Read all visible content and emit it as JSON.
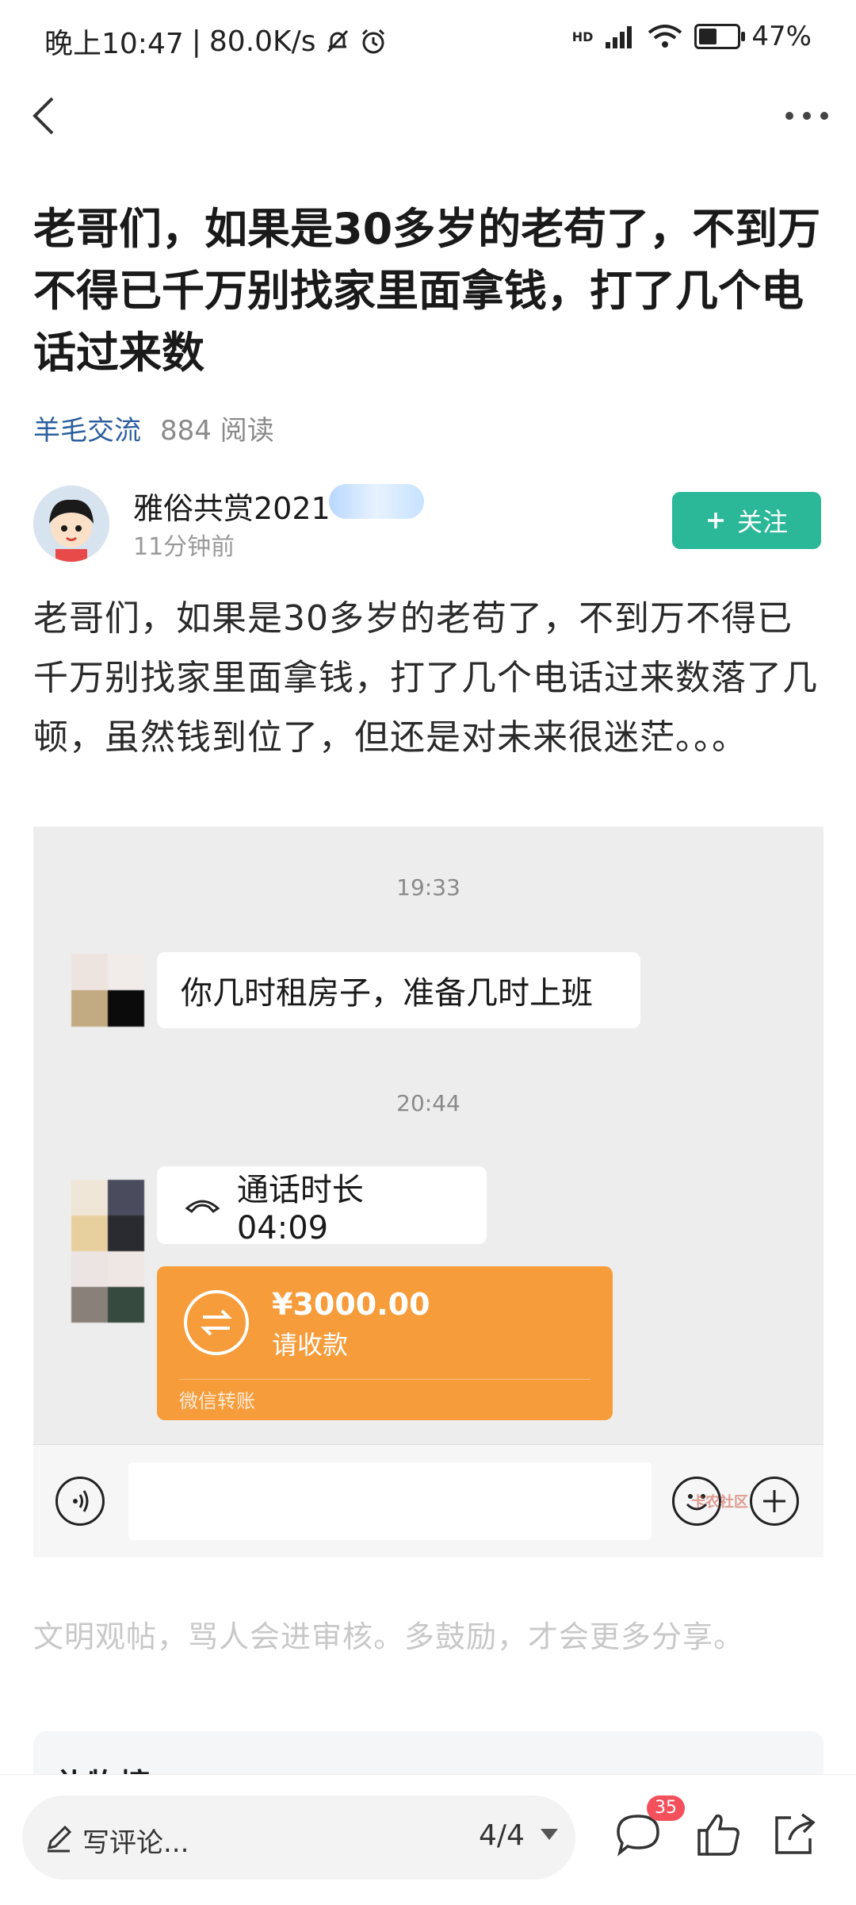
{
  "status_bar": {
    "time": "晚上10:47",
    "speed": "80.0K/s",
    "network": "HD",
    "battery": "47%",
    "battery_level": 0.47
  },
  "post": {
    "title": "老哥们，如果是30多岁的老苟了，不到万不得已千万别找家里面拿钱，打了几个电话过来数",
    "category": "羊毛交流",
    "read_count": "884 阅读",
    "author": {
      "name": "雅俗共赏2021",
      "time": "11分钟前"
    },
    "follow_label": "关注",
    "body": "老哥们，如果是30多岁的老苟了，不到万不得已千万别找家里面拿钱，打了几个电话过来数落了几顿，虽然钱到位了，但还是对未来很迷茫。。。",
    "hint": "文明观帖，骂人会进审核。多鼓励，才会更多分享。"
  },
  "chat": {
    "time1": "19:33",
    "message1": "你几时租房子，准备几时上班",
    "time2": "20:44",
    "call_text": "通话时长 04:09",
    "transfer_amount": "¥3000.00",
    "transfer_sub": "请收款",
    "transfer_footer": "微信转账",
    "watermark": "卡农社区"
  },
  "gift_panel": {
    "title": "礼物榜"
  },
  "bottom_bar": {
    "comment_placeholder": "写评论...",
    "page_indicator": "4/4",
    "comment_count": "35"
  },
  "colors": {
    "accent_green": "#2ab898",
    "category_blue": "#2b5f9e",
    "transfer_orange": "#f79c3a",
    "badge_red": "#f4505c"
  }
}
